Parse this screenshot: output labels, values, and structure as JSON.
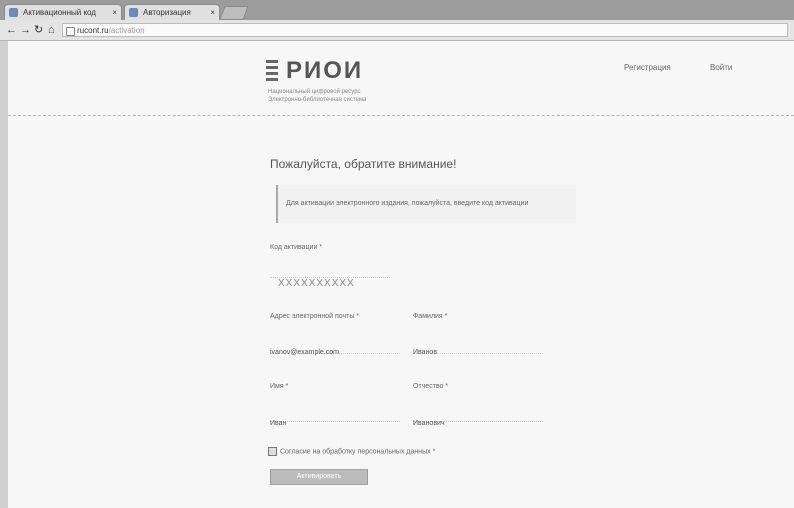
{
  "browser": {
    "tabs": [
      {
        "title": "Активационный код"
      },
      {
        "title": "Авторизация"
      }
    ],
    "url": {
      "host": "rucont.ru",
      "path": "/activation"
    }
  },
  "header": {
    "logo_text": "РИОИ",
    "logo_sub1": "Национальный цифровой ресурс",
    "logo_sub2": "Электронно-библиотечная система",
    "links": {
      "register": "Регистрация",
      "login": "Войти"
    }
  },
  "main": {
    "title": "Пожалуйста, обратите внимание!",
    "notice": "Для активации электронного издания, пожалуйста, введите код активации",
    "code_label": "Код активации *",
    "code_value": "XXXXXXXXXX",
    "email_label": "Адрес электронной почты *",
    "email_value": "ivanov@example.com",
    "surname_label": "Фамилия *",
    "surname_value": "Иванов",
    "name_label": "Имя *",
    "name_value": "Иван",
    "patronymic_label": "Отчество *",
    "patronymic_value": "Иванович",
    "consent_label": "Согласие на обработку персональных данных *",
    "submit_label": "Активировать"
  }
}
